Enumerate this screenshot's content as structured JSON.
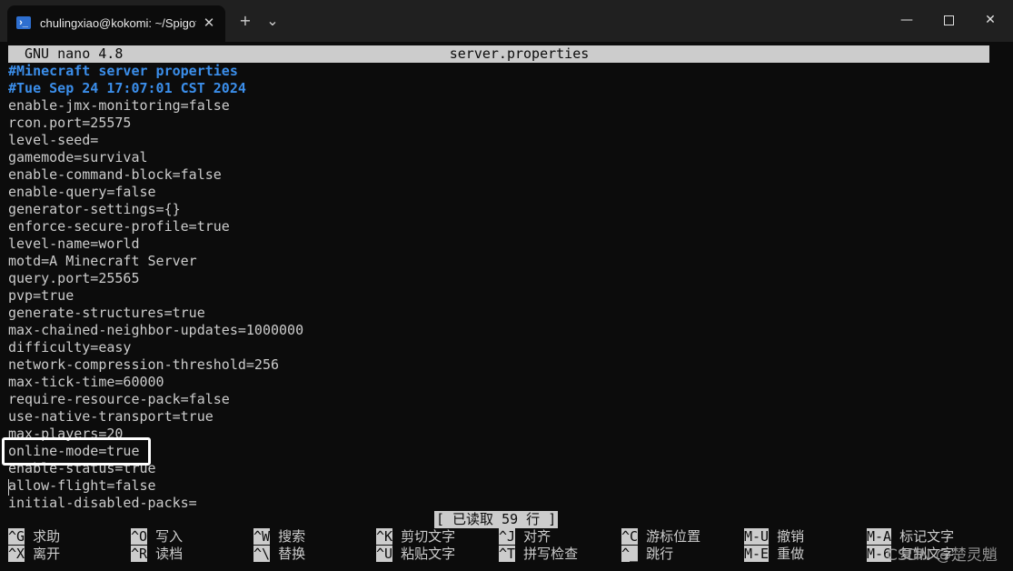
{
  "window": {
    "tab_title": "chulingxiao@kokomi: ~/Spigot",
    "tab_icon": "terminal-icon",
    "tab_close": "✕",
    "new_tab": "+",
    "dropdown": "⌄",
    "minimize": "—",
    "close": "✕"
  },
  "nano": {
    "app": "GNU nano 4.8",
    "filename": "server.properties",
    "status": "[ 已读取 59 行 ]"
  },
  "file_lines": [
    {
      "text": "#Minecraft server properties",
      "comment": true
    },
    {
      "text": "#Tue Sep 24 17:07:01 CST 2024",
      "comment": true
    },
    {
      "text": "enable-jmx-monitoring=false",
      "comment": false
    },
    {
      "text": "rcon.port=25575",
      "comment": false
    },
    {
      "text": "level-seed=",
      "comment": false
    },
    {
      "text": "gamemode=survival",
      "comment": false
    },
    {
      "text": "enable-command-block=false",
      "comment": false
    },
    {
      "text": "enable-query=false",
      "comment": false
    },
    {
      "text": "generator-settings={}",
      "comment": false
    },
    {
      "text": "enforce-secure-profile=true",
      "comment": false
    },
    {
      "text": "level-name=world",
      "comment": false
    },
    {
      "text": "motd=A Minecraft Server",
      "comment": false
    },
    {
      "text": "query.port=25565",
      "comment": false
    },
    {
      "text": "pvp=true",
      "comment": false
    },
    {
      "text": "generate-structures=true",
      "comment": false
    },
    {
      "text": "max-chained-neighbor-updates=1000000",
      "comment": false
    },
    {
      "text": "difficulty=easy",
      "comment": false
    },
    {
      "text": "network-compression-threshold=256",
      "comment": false
    },
    {
      "text": "max-tick-time=60000",
      "comment": false
    },
    {
      "text": "require-resource-pack=false",
      "comment": false
    },
    {
      "text": "use-native-transport=true",
      "comment": false
    },
    {
      "text": "max-players=20",
      "comment": false
    },
    {
      "text": "online-mode=true",
      "comment": false
    },
    {
      "text": "enable-status=true",
      "comment": false
    },
    {
      "text": "allow-flight=false",
      "comment": false
    },
    {
      "text": "initial-disabled-packs=",
      "comment": false
    }
  ],
  "shortcuts": {
    "row1": [
      {
        "key": "^G",
        "label": "求助"
      },
      {
        "key": "^O",
        "label": "写入"
      },
      {
        "key": "^W",
        "label": "搜索"
      },
      {
        "key": "^K",
        "label": "剪切文字"
      },
      {
        "key": "^J",
        "label": "对齐"
      },
      {
        "key": "^C",
        "label": "游标位置"
      },
      {
        "key": "M-U",
        "label": "撤销"
      },
      {
        "key": "M-A",
        "label": "标记文字"
      }
    ],
    "row2": [
      {
        "key": "^X",
        "label": "离开"
      },
      {
        "key": "^R",
        "label": "读档"
      },
      {
        "key": "^\\",
        "label": "替换"
      },
      {
        "key": "^U",
        "label": "粘贴文字"
      },
      {
        "key": "^T",
        "label": "拼写检查"
      },
      {
        "key": "^_",
        "label": "跳行"
      },
      {
        "key": "M-E",
        "label": "重做"
      },
      {
        "key": "M-6",
        "label": "复制文字"
      }
    ]
  },
  "watermark": "CSDN @楚灵魈"
}
